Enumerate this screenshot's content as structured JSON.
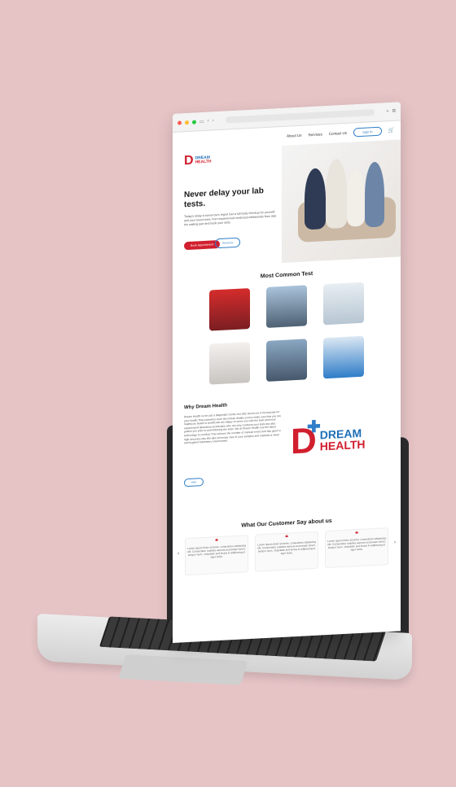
{
  "colors": {
    "background": "#e6c4c6",
    "brand_red": "#d11f2e",
    "brand_blue": "#1f6fb7",
    "accent_blue": "#2f7dc8"
  },
  "nav": {
    "items": [
      "About Us",
      "Services",
      "Contact Us"
    ],
    "signin": "Sign In"
  },
  "hero": {
    "title": "Never delay your lab tests.",
    "body": "Today's delay is tomorrow's regret Get a full body checkup for yourself and your loved ones, from experienced medical professionals Now skip the waiting part and book your slots.",
    "primary": "Book Appointment",
    "secondary": "Services"
  },
  "logo": {
    "brand_line1": "DREAM",
    "brand_line2": "HEALTH",
    "mark": "D"
  },
  "tests": {
    "title": "Most Common Test"
  },
  "why": {
    "title": "Why Dream Health",
    "body": "Dream Health is not just a diagnostic center, but also serves as a microscope for your health.That examines even the minute details, just to make sure that you are healthy,as health is wealth.We are happy to serve you with the best and most experienced laboratory technicians who not only conducts your tests but also guides you prior to and following the tests. We at Dream Health use the latest technology to conduct.This reduces the number of manual errors and has given a high accuracy rate.We take immense care of your samples and maintain a clean and hygienic laboratory environment.",
    "button": "Info"
  },
  "testimonials": {
    "title": "What Our Customer Say about us",
    "cards": [
      "Lorem ipsum dolor sit amet, consectetur adipiscing elit. Consectetur sodales aenean accumsan lorem, tempor nunc. Vulputate sed lectus in adipiscing et eget nulla.",
      "Lorem ipsum dolor sit amet, consectetur adipiscing elit. Consectetur sodales aenean accumsan lorem, tempor nunc. Vulputate sed lectus in adipiscing et eget nulla.",
      "Lorem ipsum dolor sit amet, consectetur adipiscing elit. Consectetur sodales aenean accumsan lorem, tempor nunc. Vulputate sed lectus in adipiscing et eget nulla."
    ]
  }
}
